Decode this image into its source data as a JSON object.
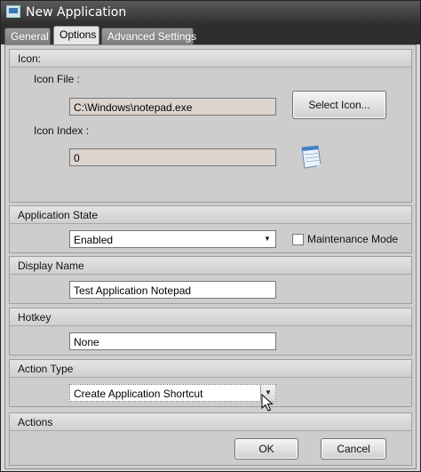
{
  "window": {
    "title": "New Application"
  },
  "tabs": [
    {
      "label": "General",
      "active": false
    },
    {
      "label": "Options",
      "active": true
    },
    {
      "label": "Advanced Settings",
      "active": false
    }
  ],
  "icon_section": {
    "header": "Icon:",
    "icon_file_label": "Icon File :",
    "icon_file_value": "C:\\Windows\\notepad.exe",
    "select_icon_button": "Select Icon...",
    "icon_index_label": "Icon Index :",
    "icon_index_value": "0",
    "preview_icon": "notepad-icon"
  },
  "application_state": {
    "header": "Application State",
    "selected": "Enabled",
    "maintenance_mode_label": "Maintenance Mode",
    "maintenance_mode_checked": false
  },
  "display_name": {
    "header": "Display Name",
    "value": "Test Application Notepad"
  },
  "hotkey": {
    "header": "Hotkey",
    "value": "None"
  },
  "action_type": {
    "header": "Action Type",
    "selected": "Create Application Shortcut"
  },
  "actions": {
    "header": "Actions",
    "ok_label": "OK",
    "cancel_label": "Cancel"
  }
}
